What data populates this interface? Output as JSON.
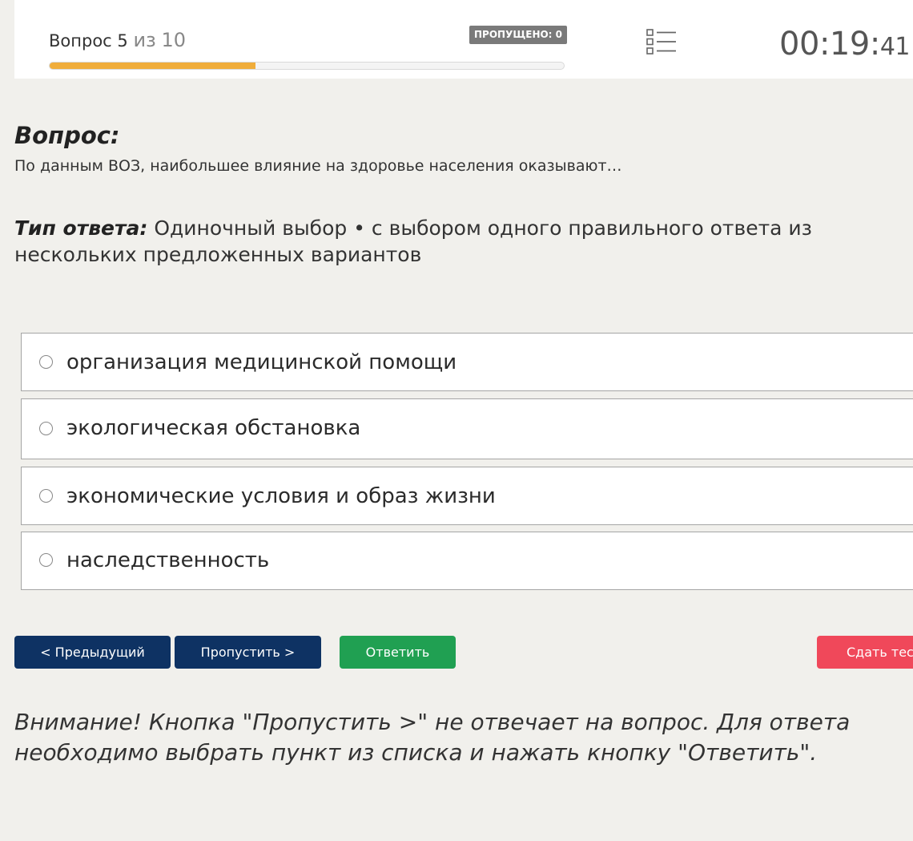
{
  "header": {
    "question_prefix": "Вопрос 5",
    "of_word": "из",
    "total": "10",
    "progress_fraction": 0.4,
    "skipped_badge": "ПРОПУЩЕНО: 0",
    "list_icon": "question-list-icon",
    "timer_main": "00:19",
    "timer_sep": ":",
    "timer_seconds": "41"
  },
  "question": {
    "heading": "Вопрос:",
    "text": "По данным ВОЗ, наибольшее влияние на здоровье населения оказывают…"
  },
  "answer_type": {
    "label": "Тип ответа:",
    "value": "Одиночный выбор • с выбором одного правильного ответа из нескольких предложенных вариантов"
  },
  "options": [
    {
      "label": "организация медицинской помощи"
    },
    {
      "label": "экологическая обстановка"
    },
    {
      "label": "экономические условия и образ жизни"
    },
    {
      "label": "наследственность"
    }
  ],
  "buttons": {
    "prev": "< Предыдущий",
    "skip": "Пропустить >",
    "answer": "Ответить",
    "submit": "Сдать тест"
  },
  "colors": {
    "navy": "#0e3263",
    "green": "#20a052",
    "red": "#f0485a",
    "progress": "#f0ad3b"
  },
  "warning": "Внимание! Кнопка \"Пропустить >\" не отвечает на вопрос. Для ответа необходимо выбрать пункт из списка и нажать кнопку \"Ответить\"."
}
